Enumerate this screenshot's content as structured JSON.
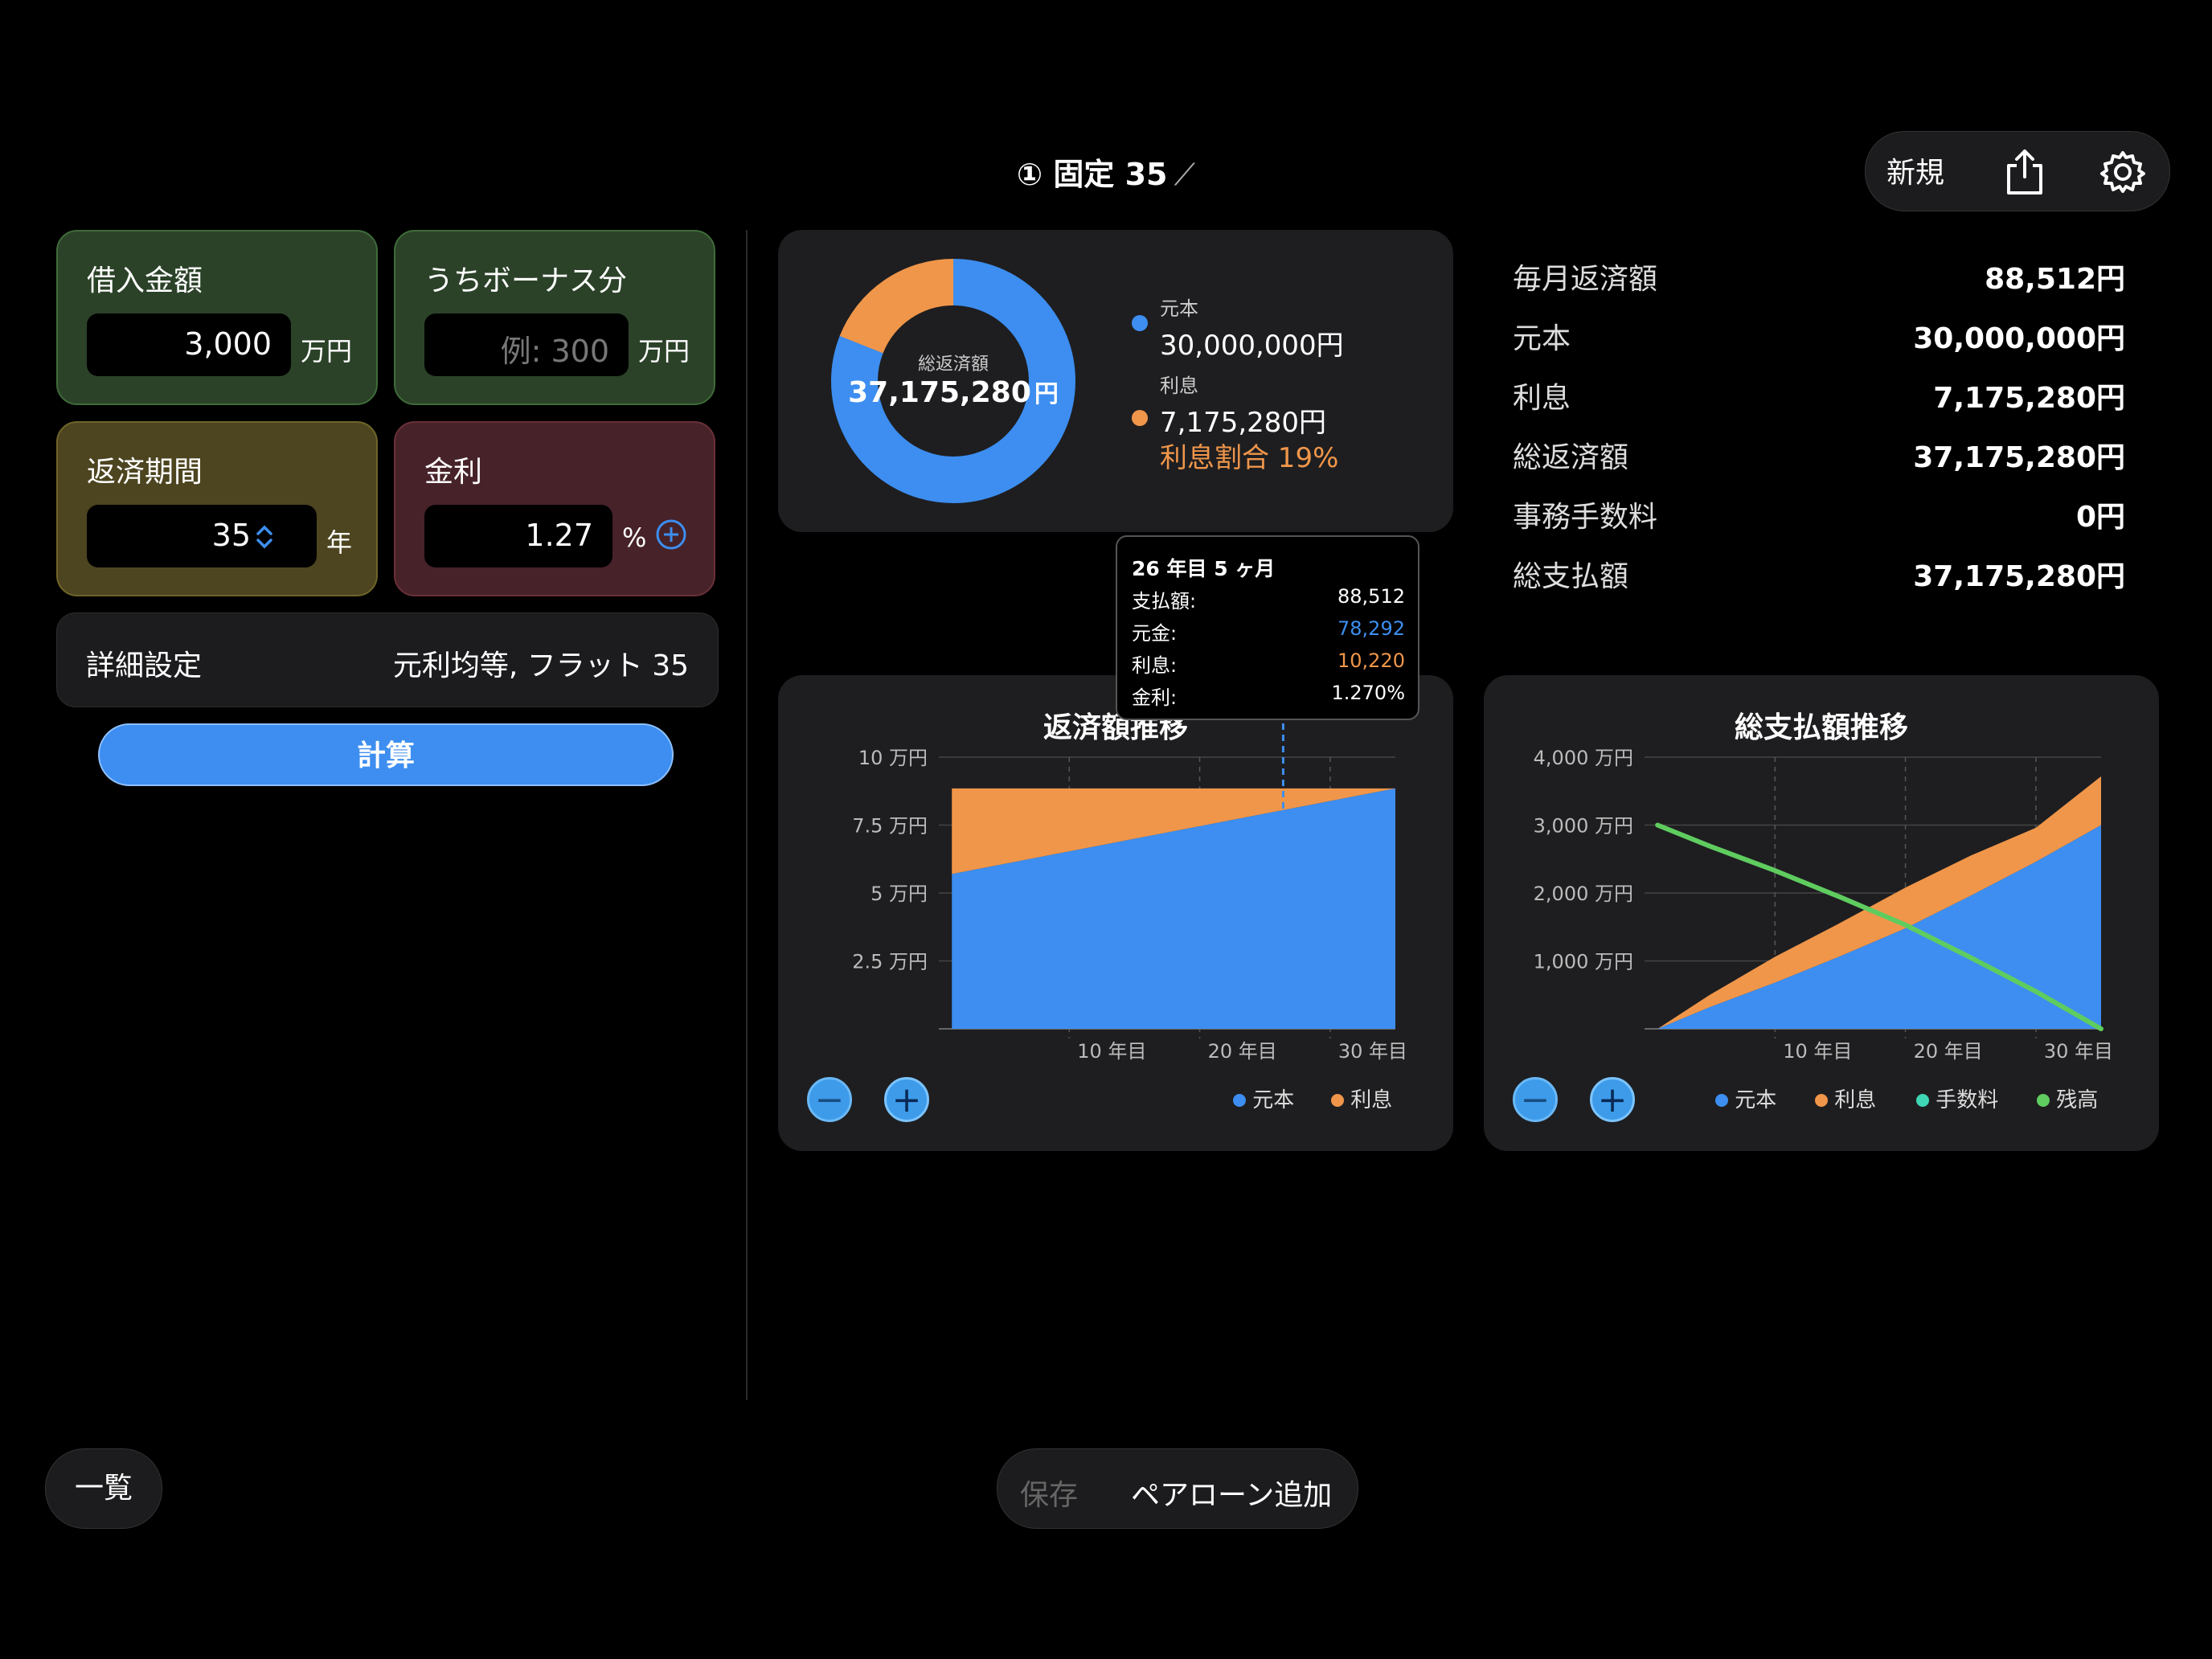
{
  "header": {
    "title": "① 固定 35",
    "edit_icon": "pencil-icon",
    "new_label": "新規",
    "share_icon": "share-icon",
    "settings_icon": "gear-icon"
  },
  "inputs": {
    "loan_amount": {
      "label": "借入金額",
      "value": "3,000",
      "unit": "万円"
    },
    "bonus_portion": {
      "label": "うちボーナス分",
      "placeholder": "例: 300",
      "unit": "万円"
    },
    "term": {
      "label": "返済期間",
      "value": "35",
      "unit": "年"
    },
    "rate": {
      "label": "金利",
      "value": "1.27",
      "unit": "%"
    }
  },
  "detail_settings": {
    "label": "詳細設定",
    "value": "元利均等, フラット 35"
  },
  "calculate_label": "計算",
  "donut": {
    "center_label": "総返済額",
    "center_value": "37,175,280",
    "center_unit": "円",
    "principal_label": "元本",
    "principal_value": "30,000,000円",
    "interest_label": "利息",
    "interest_value": "7,175,280円",
    "interest_ratio": "利息割合 19%",
    "principal_color": "#3d8ef0",
    "interest_color": "#f0964a",
    "principal_share": 0.81,
    "interest_share": 0.19
  },
  "summary": [
    {
      "label": "毎月返済額",
      "value": "88,512円"
    },
    {
      "label": "元本",
      "value": "30,000,000円"
    },
    {
      "label": "利息",
      "value": "7,175,280円"
    },
    {
      "label": "総返済額",
      "value": "37,175,280円"
    },
    {
      "label": "事務手数料",
      "value": "0円"
    },
    {
      "label": "総支払額",
      "value": "37,175,280円"
    }
  ],
  "tooltip": {
    "title": "26 年目 5 ヶ月",
    "rows": [
      {
        "label": "支払額:",
        "value": "88,512",
        "color": "#ffffff"
      },
      {
        "label": "元金:",
        "value": "78,292",
        "color": "#3d8ef0"
      },
      {
        "label": "利息:",
        "value": "10,220",
        "color": "#f0964a"
      },
      {
        "label": "金利:",
        "value": "1.270%",
        "color": "#ffffff"
      }
    ]
  },
  "chart_data": [
    {
      "type": "area",
      "title": "返済額推移",
      "x_ticks": [
        "10 年目",
        "20 年目",
        "30 年目"
      ],
      "y_ticks": [
        "2.5 万円",
        "5 万円",
        "7.5 万円",
        "10 万円"
      ],
      "ylim": [
        0,
        10
      ],
      "xlim": [
        0,
        35
      ],
      "x": [
        1,
        35
      ],
      "series": [
        {
          "name": "元本",
          "values": [
            5.7,
            8.85
          ],
          "color": "#3d8ef0"
        },
        {
          "name": "利息",
          "values": [
            3.15,
            0.0
          ],
          "color": "#f0964a"
        }
      ],
      "cursor_x": 26.4,
      "grid": true
    },
    {
      "type": "area",
      "title": "総支払額推移",
      "x_ticks": [
        "10 年目",
        "20 年目",
        "30 年目"
      ],
      "y_ticks": [
        "1,000 万円",
        "2,000 万円",
        "3,000 万円",
        "4,000 万円"
      ],
      "ylim": [
        0,
        4000
      ],
      "xlim": [
        0,
        35
      ],
      "x": [
        1,
        5,
        10,
        15,
        20,
        25,
        30,
        35
      ],
      "series": [
        {
          "name": "元本",
          "values": [
            0,
            320,
            680,
            1070,
            1480,
            1960,
            2460,
            3000
          ],
          "color": "#3d8ef0"
        },
        {
          "name": "利息",
          "values": [
            0,
            180,
            380,
            490,
            600,
            590,
            500,
            718
          ],
          "color": "#f0964a"
        },
        {
          "name": "手数料",
          "values": [
            0,
            0,
            0,
            0,
            0,
            0,
            0,
            0
          ],
          "color": "#3ed6b4"
        },
        {
          "name": "残高",
          "values": [
            3000,
            2690,
            2330,
            1940,
            1530,
            1050,
            550,
            0
          ],
          "color": "#5fcc5f"
        }
      ],
      "grid": true
    }
  ],
  "chart_controls": {
    "zoom_out": "−",
    "zoom_in": "+"
  },
  "bottom": {
    "list_label": "一覧",
    "save_label": "保存",
    "pair_loan_label": "ペアローン追加"
  }
}
